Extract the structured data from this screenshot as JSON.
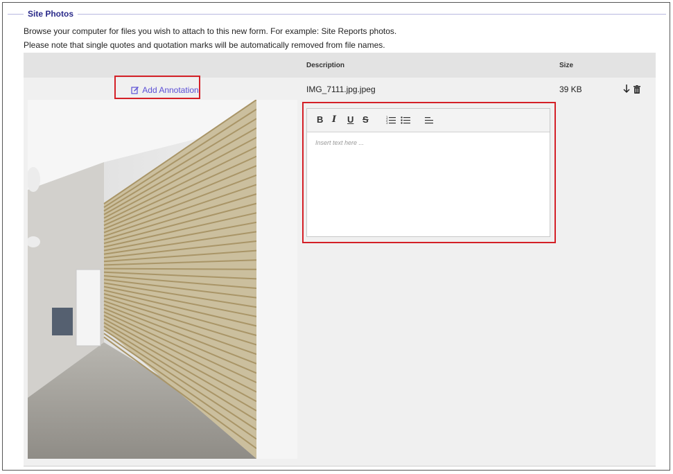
{
  "section": {
    "legend": "Site Photos",
    "help_line1": "Browse your computer for files you wish to attach to this new form. For example: Site Reports photos.",
    "help_line2": "Please note that single quotes and quotation marks will be automatically removed from file names."
  },
  "table": {
    "headers": {
      "description": "Description",
      "size": "Size"
    },
    "rows": [
      {
        "annotation_label": "Add Annotation",
        "filename": "IMG_7111.jpg.jpeg",
        "size": "39 KB",
        "photo": "photo of hallway with wooden slat wall panel",
        "editor": {
          "placeholder": "Insert text here ...",
          "toolbar": [
            "B",
            "I",
            "U",
            "S",
            "ordered-list",
            "bullet-list",
            "align"
          ]
        }
      }
    ]
  },
  "colors": {
    "link": "#5b4fd6",
    "highlight": "#d41f26",
    "legend": "#2a2a8a"
  },
  "icons": [
    "annotate-icon",
    "download-icon",
    "trash-icon",
    "ordered-list-icon",
    "bullet-list-icon",
    "align-left-icon"
  ]
}
